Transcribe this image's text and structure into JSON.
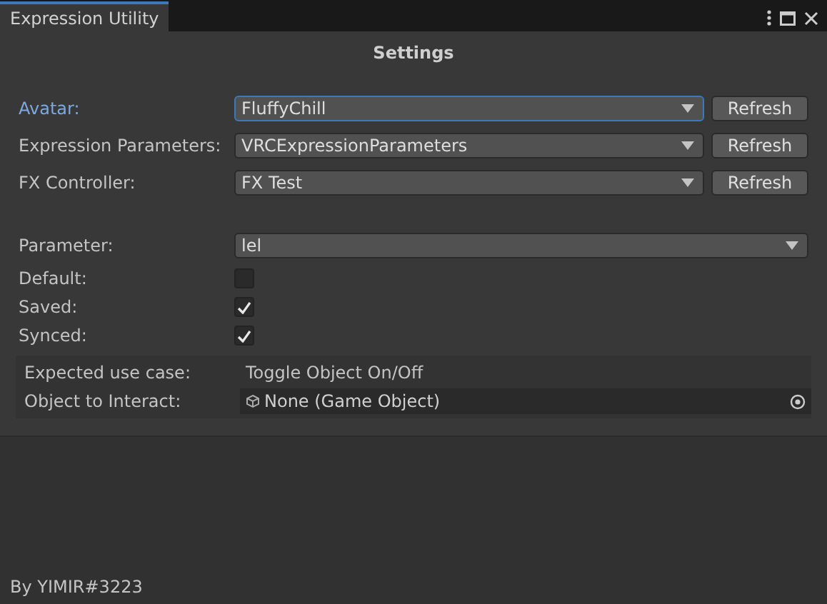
{
  "window": {
    "tab": "Expression Utility"
  },
  "title": "Settings",
  "selectors": [
    {
      "label": "Avatar:",
      "value": "FluffyChill",
      "button": "Refresh",
      "focused": true
    },
    {
      "label": "Expression Parameters:",
      "value": "VRCExpressionParameters",
      "button": "Refresh",
      "focused": false
    },
    {
      "label": "FX Controller:",
      "value": "FX Test",
      "button": "Refresh",
      "focused": false
    }
  ],
  "parameter": {
    "label": "Parameter:",
    "value": "lel"
  },
  "toggles": [
    {
      "label": "Default:",
      "checked": false
    },
    {
      "label": "Saved:",
      "checked": true
    },
    {
      "label": "Synced:",
      "checked": true
    }
  ],
  "info": {
    "use_case_label": "Expected use case:",
    "use_case": "Toggle Object On/Off",
    "object_label": "Object to Interact:",
    "object_value": "None (Game Object)"
  },
  "footer": "By YIMIR#3223"
}
